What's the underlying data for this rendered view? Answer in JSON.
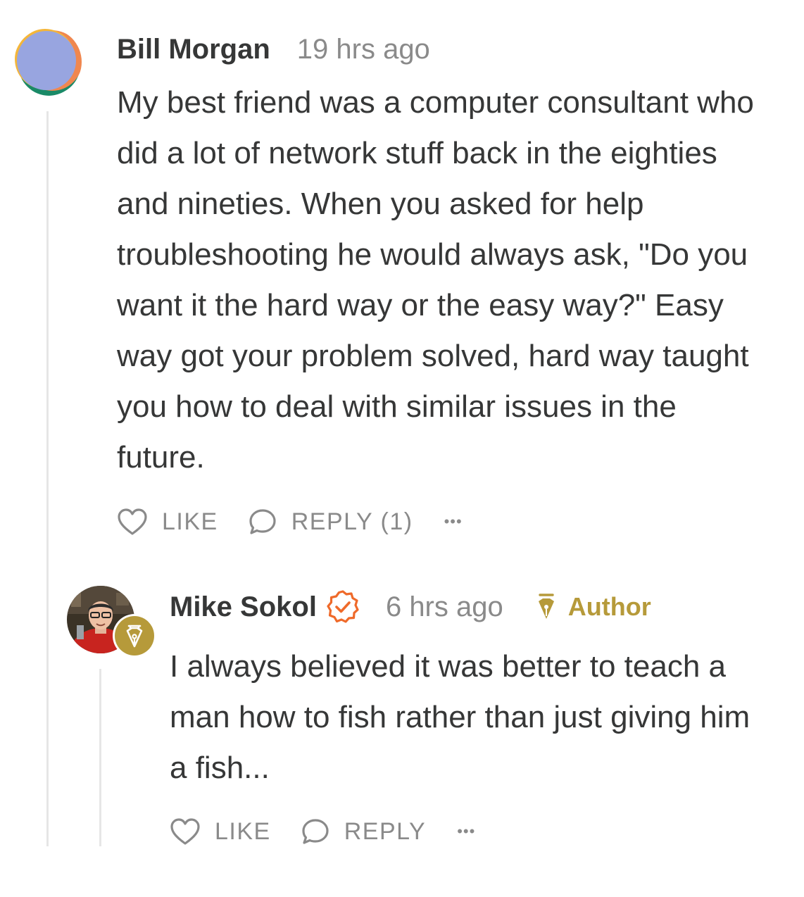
{
  "comments": [
    {
      "author": "Bill Morgan",
      "time": "19 hrs ago",
      "body": "My best friend was a computer consultant who did a lot of network stuff back in the eighties and nineties. When you asked for help troubleshooting he would always ask, \"Do you want it the hard way or the easy way?\" Easy way got your problem solved, hard way taught you how to deal with similar issues in the future.",
      "like_label": "LIKE",
      "reply_label": "REPLY (1)",
      "more_label": "•••",
      "avatar_colors": [
        "#98a5e0",
        "#f0874f",
        "#1a8a67",
        "#f4b63a"
      ]
    },
    {
      "author": "Mike Sokol",
      "time": "6 hrs ago",
      "author_tag": "Author",
      "body": "I always believed it was better to teach a man how to fish rather than just giving him a fish...",
      "like_label": "LIKE",
      "reply_label": "REPLY",
      "more_label": "•••",
      "verified": true
    }
  ],
  "colors": {
    "text": "#363737",
    "muted": "#8a8a8a",
    "author_gold": "#b69a3a",
    "verified_orange": "#ef6a2a",
    "thread_line": "#e6e6e6"
  },
  "icons": [
    "heart-icon",
    "comment-bubble-icon",
    "more-icon",
    "verified-check-icon",
    "fountain-pen-icon"
  ]
}
